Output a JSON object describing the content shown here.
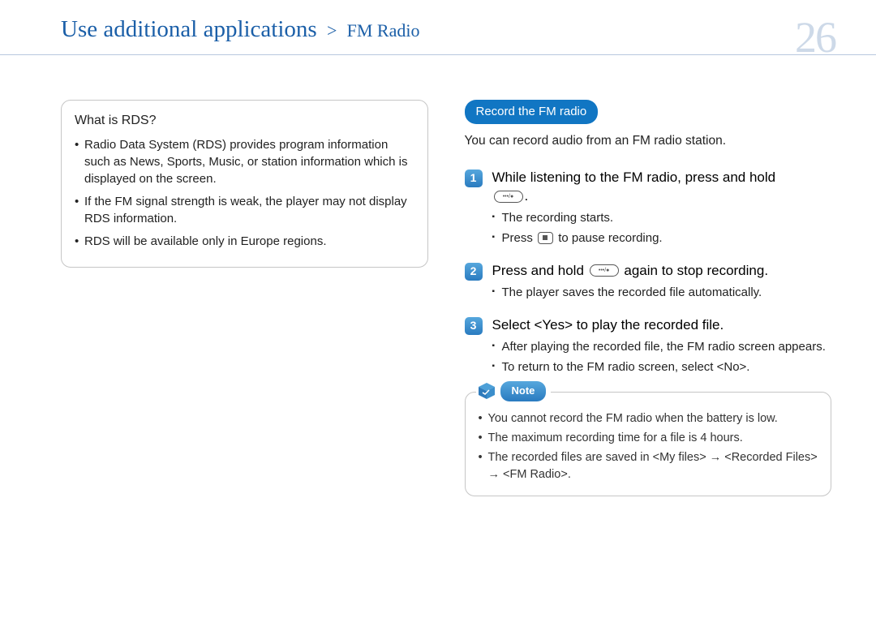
{
  "header": {
    "breadcrumb_main": "Use additional applications",
    "breadcrumb_sub": "FM Radio",
    "page_number": "26"
  },
  "left": {
    "box_title": "What is RDS?",
    "items": [
      "Radio Data System (RDS) provides program information such as News, Sports, Music, or station information which is displayed on the screen.",
      "If the FM signal strength is weak, the player may not display RDS information.",
      "RDS will be available only in Europe regions."
    ]
  },
  "right": {
    "section_title": "Record the FM radio",
    "lead": "You can record audio from an FM radio station.",
    "steps": [
      {
        "num": "1",
        "title_pre": "While listening to the FM radio, press and hold ",
        "title_post": ".",
        "has_btn": true,
        "subs": [
          {
            "text": "The recording starts."
          },
          {
            "pre": "Press ",
            "stop_btn": true,
            "post": " to pause recording."
          }
        ]
      },
      {
        "num": "2",
        "title_pre": "Press and hold ",
        "has_btn": true,
        "title_post": " again to stop recording.",
        "subs": [
          {
            "text": "The player saves the recorded file automatically."
          }
        ]
      },
      {
        "num": "3",
        "title_pre": "Select <Yes> to play the recorded file.",
        "has_btn": false,
        "title_post": "",
        "subs": [
          {
            "text": "After playing the recorded file, the FM radio screen appears."
          },
          {
            "text": "To return to the FM radio screen, select <No>."
          }
        ]
      }
    ],
    "note_label": "Note",
    "note_items": [
      "You cannot record the FM radio when the battery is low.",
      "The maximum recording time for a file is 4 hours.",
      "The recorded files are saved in <My files> → <Recorded Files> → <FM Radio>."
    ]
  }
}
